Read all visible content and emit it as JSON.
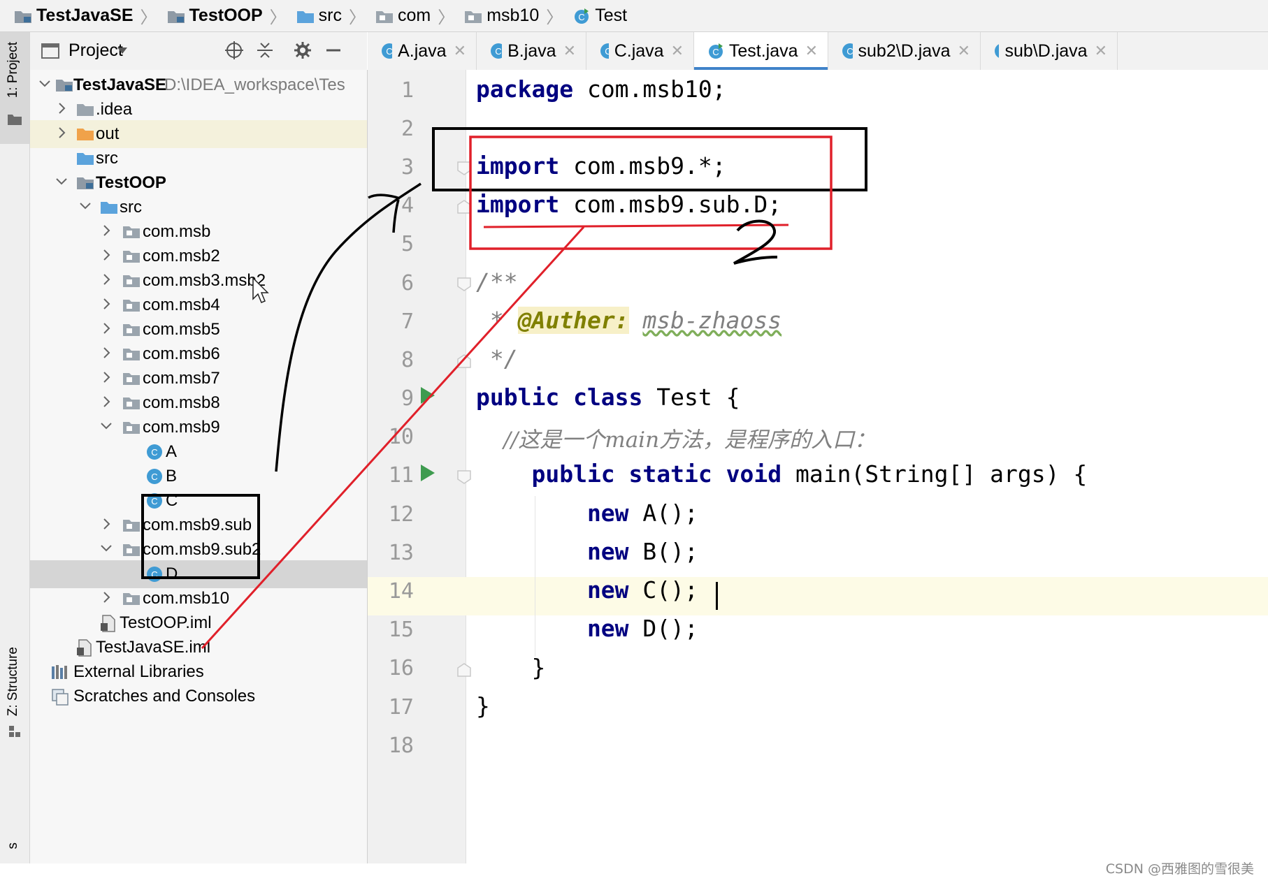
{
  "breadcrumb": [
    {
      "label": "TestJavaSE",
      "icon": "module-folder-icon",
      "bold": true
    },
    {
      "label": "TestOOP",
      "icon": "module-folder-icon",
      "bold": true
    },
    {
      "label": "src",
      "icon": "source-folder-icon",
      "bold": false
    },
    {
      "label": "com",
      "icon": "package-folder-icon",
      "bold": false
    },
    {
      "label": "msb10",
      "icon": "package-folder-icon",
      "bold": false
    },
    {
      "label": "Test",
      "icon": "java-class-icon",
      "bold": false
    }
  ],
  "left_strip": {
    "project_tab": "1: Project",
    "structure_tab": "Z: Structure",
    "bottom_tab": "s"
  },
  "project_panel": {
    "title": "Project",
    "tree": [
      {
        "label": "TestJavaSE",
        "extra": "D:\\IDEA_workspace\\Tes",
        "type": "module",
        "expand": "open"
      },
      {
        "label": ".idea",
        "type": "folder",
        "expand": "closed"
      },
      {
        "label": "out",
        "type": "out-folder",
        "expand": "closed"
      },
      {
        "label": "src",
        "type": "source-folder",
        "expand": "none"
      },
      {
        "label": "TestOOP",
        "type": "module",
        "expand": "open"
      },
      {
        "label": "src",
        "type": "source-folder",
        "expand": "open"
      },
      {
        "label": "com.msb",
        "type": "package",
        "expand": "closed"
      },
      {
        "label": "com.msb2",
        "type": "package",
        "expand": "closed"
      },
      {
        "label": "com.msb3.msb2",
        "type": "package",
        "expand": "closed"
      },
      {
        "label": "com.msb4",
        "type": "package",
        "expand": "closed"
      },
      {
        "label": "com.msb5",
        "type": "package",
        "expand": "closed"
      },
      {
        "label": "com.msb6",
        "type": "package",
        "expand": "closed"
      },
      {
        "label": "com.msb7",
        "type": "package",
        "expand": "closed"
      },
      {
        "label": "com.msb8",
        "type": "package",
        "expand": "closed"
      },
      {
        "label": "com.msb9",
        "type": "package",
        "expand": "open"
      },
      {
        "label": "A",
        "type": "class",
        "expand": "none"
      },
      {
        "label": "B",
        "type": "class",
        "expand": "none"
      },
      {
        "label": "C",
        "type": "class",
        "expand": "none"
      },
      {
        "label": "com.msb9.sub",
        "type": "package",
        "expand": "closed"
      },
      {
        "label": "com.msb9.sub2",
        "type": "package",
        "expand": "open"
      },
      {
        "label": "D",
        "type": "class",
        "expand": "none",
        "selected": true
      },
      {
        "label": "com.msb10",
        "type": "package",
        "expand": "closed"
      },
      {
        "label": "TestOOP.iml",
        "type": "iml",
        "expand": "none"
      },
      {
        "label": "TestJavaSE.iml",
        "type": "iml",
        "expand": "none"
      },
      {
        "label": "External Libraries",
        "type": "libraries",
        "expand": "closed"
      },
      {
        "label": "Scratches and Consoles",
        "type": "scratches",
        "expand": "none"
      }
    ]
  },
  "tabs": [
    {
      "label": "A.java",
      "active": false
    },
    {
      "label": "B.java",
      "active": false
    },
    {
      "label": "C.java",
      "active": false
    },
    {
      "label": "Test.java",
      "active": true
    },
    {
      "label": "sub2\\D.java",
      "active": false
    },
    {
      "label": "sub\\D.java",
      "active": false
    }
  ],
  "editor": {
    "line_numbers": [
      "1",
      "2",
      "3",
      "4",
      "5",
      "6",
      "7",
      "8",
      "9",
      "10",
      "11",
      "12",
      "13",
      "14",
      "15",
      "16",
      "17",
      "18"
    ],
    "current_line": "14",
    "code": {
      "l1_kw": "package",
      "l1_rest": " com.msb10;",
      "l3_kw": "import",
      "l3_rest": " com.msb9.*;",
      "l4_kw": "import",
      "l4_rest": " com.msb9.sub.D;",
      "l6": "/**",
      "l7_star": " * ",
      "l7_tag": "@Auther:",
      "l7_sp": " ",
      "l7_author": "msb-zhaoss",
      "l8": " */",
      "l9_kw": "public class",
      "l9_rest": " Test {",
      "l10": "    //这是一个main方法，是程序的入口：",
      "l11_kw": "    public static void",
      "l11_rest": " main(String[] args) {",
      "l12_kw": "        new",
      "l12_rest": " A();",
      "l13_kw": "        new",
      "l13_rest": " B();",
      "l14_kw": "        new",
      "l14_rest": " C();",
      "l15_kw": "        new",
      "l15_rest": " D();",
      "l16": "    }",
      "l17": "}"
    }
  },
  "annotations": {
    "handwritten_1": "1",
    "handwritten_2": "2"
  },
  "watermark": "CSDN @西雅图的雪很美",
  "colors": {
    "keyword": "#000080",
    "comment": "#808080",
    "annotation": "#808000",
    "accent": "#4083c9",
    "run_icon": "#3e9b4f",
    "red_markup": "#e0202a"
  }
}
